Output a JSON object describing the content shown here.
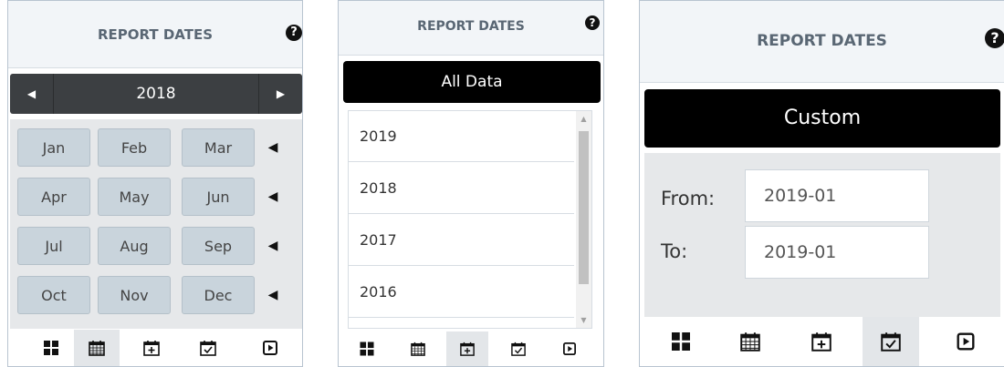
{
  "panels": [
    {
      "title": "REPORT DATES",
      "help_icon": "question-circle-icon",
      "year": "2018",
      "months": [
        "Jan",
        "Feb",
        "Mar",
        "Apr",
        "May",
        "Jun",
        "Jul",
        "Aug",
        "Sep",
        "Oct",
        "Nov",
        "Dec"
      ],
      "active_tab": "month-view"
    },
    {
      "title": "REPORT DATES",
      "help_icon": "question-circle-icon",
      "selected_range": "All Data",
      "years": [
        "2019",
        "2018",
        "2017",
        "2016"
      ],
      "active_tab": "custom-add-view"
    },
    {
      "title": "REPORT DATES",
      "help_icon": "question-circle-icon",
      "selected_range": "Custom",
      "from_label": "From:",
      "from_value": "2019-01",
      "to_label": "To:",
      "to_value": "2019-01",
      "active_tab": "custom-check-view"
    }
  ],
  "toolbar_icons": [
    "grid-icon",
    "calendar-icon",
    "calendar-plus-icon",
    "calendar-check-icon",
    "play-square-icon"
  ],
  "colors": {
    "header_bg": "#f2f5f8",
    "dark_bar": "#3c3f42",
    "black_button": "#000000",
    "month_button": "#c9d4dc",
    "area_bg": "#e6e8ea"
  }
}
